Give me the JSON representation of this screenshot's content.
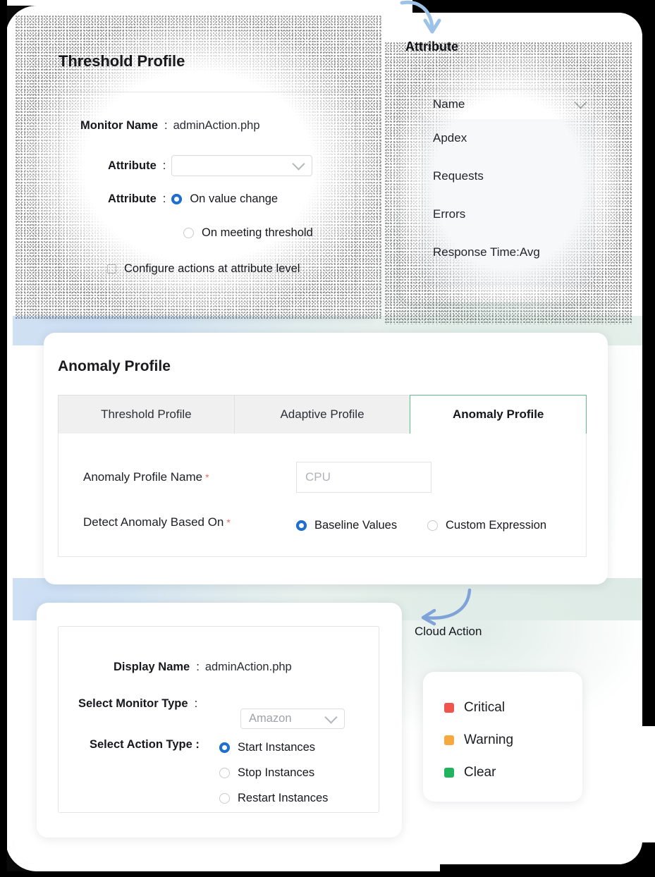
{
  "background": {
    "gradient_from": "#d3e2f3",
    "gradient_mid": "#c9ddf4",
    "gradient_to": "#e5efea"
  },
  "threshold_card": {
    "title": "Threshold Profile",
    "monitor_name_label": "Monitor Name",
    "colon": ":",
    "monitor_name_value": "adminAction.php",
    "attribute_label": "Attribute",
    "attribute_select_placeholder": "",
    "attribute2_label": "Attribute",
    "radios": [
      {
        "label": "On value change",
        "selected": true
      },
      {
        "label": "On meeting threshold",
        "selected": false
      }
    ],
    "checkbox": {
      "label": "Configure actions at attribute level",
      "checked": false
    }
  },
  "attribute_callout": {
    "label": "Attribute",
    "arrow": "curved-arrow-icon"
  },
  "attribute_dropdown": {
    "selected": "Name",
    "chevron": "chevron-down-icon",
    "options": [
      "Apdex",
      "Requests",
      "Errors",
      "Response Time:Avg"
    ]
  },
  "anomaly_card": {
    "title": "Anomaly Profile",
    "tabs": [
      {
        "label": "Threshold Profile",
        "active": false
      },
      {
        "label": "Adaptive Profile",
        "active": false
      },
      {
        "label": "Anomaly Profile",
        "active": true
      }
    ],
    "active_tab_border_color": "#5fb98c",
    "profile_name_label": "Anomaly Profile Name",
    "profile_name_required": "*",
    "profile_name_placeholder": "CPU",
    "detect_label": "Detect Anomaly  Based On",
    "detect_required": "*",
    "detect_options": [
      {
        "label": "Baseline Values",
        "selected": true
      },
      {
        "label": "Custom Expression",
        "selected": false
      }
    ]
  },
  "cloud_callout": {
    "label": "Cloud Action",
    "arrow": "curved-arrow-icon"
  },
  "action_card": {
    "display_name_label": "Display  Name",
    "colon": ":",
    "display_name_value": "adminAction.php",
    "monitor_type_label": "Select Monitor Type",
    "monitor_type_placeholder": "Amazon",
    "action_type_label": "Select Action Type :",
    "action_options": [
      {
        "label": "Start Instances",
        "selected": true
      },
      {
        "label": "Stop Instances",
        "selected": false
      },
      {
        "label": "Restart Instances",
        "selected": false
      }
    ]
  },
  "legend_card": {
    "items": [
      {
        "label": "Critical",
        "color": "#f0554d"
      },
      {
        "label": "Warning",
        "color": "#f5a93f"
      },
      {
        "label": "Clear",
        "color": "#22b35e"
      }
    ]
  },
  "accent": {
    "radio_blue": "#1f6fd0",
    "required_red": "#ef6b5a",
    "tab_green": "#5fb98c"
  }
}
